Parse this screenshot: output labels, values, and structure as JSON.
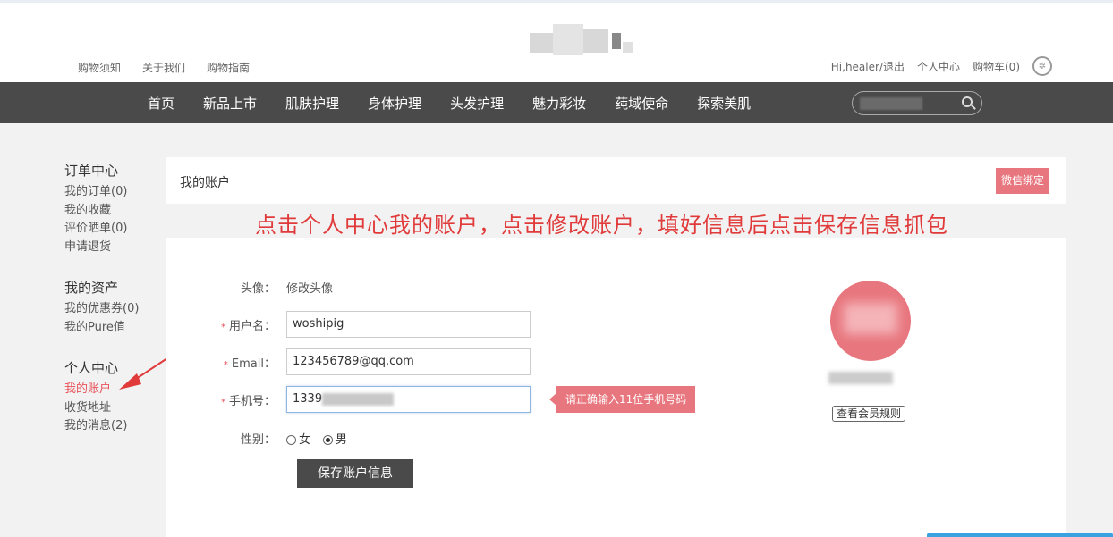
{
  "header": {
    "left_links": [
      "购物须知",
      "关于我们",
      "购物指南"
    ],
    "user_links": [
      "Hi,healer/退出",
      "个人中心",
      "购物车(0)"
    ],
    "wechat_icon": "wechat-icon"
  },
  "nav": {
    "items": [
      "首页",
      "新品上市",
      "肌肤护理",
      "身体护理",
      "头发护理",
      "魅力彩妆",
      "莼域使命",
      "探索美肌"
    ]
  },
  "sidebar": {
    "groups": [
      {
        "title": "订单中心",
        "items": [
          "我的订单(0)",
          "我的收藏",
          "评价晒单(0)",
          "申请退货"
        ]
      },
      {
        "title": "我的资产",
        "items": [
          "我的优惠券(0)",
          "我的Pure值"
        ]
      },
      {
        "title": "个人中心",
        "items": [
          "我的账户",
          "收货地址",
          "我的消息(2)"
        ]
      }
    ],
    "active_item": "我的账户"
  },
  "main": {
    "title": "我的账户",
    "wechat_bind_label": "微信绑定",
    "annotation": "点击个人中心我的账户，点击修改账户，填好信息后点击保存信息抓包",
    "form": {
      "avatar_label": "头像：",
      "avatar_link": "修改头像",
      "username_label": "用户名：",
      "username_value": "woshipig",
      "email_label": "Email：",
      "email_value": "123456789@qq.com",
      "phone_label": "手机号：",
      "phone_value": "1339",
      "phone_tip": "请正确输入11位手机号码",
      "gender_label": "性别：",
      "gender_options": [
        "女",
        "男"
      ],
      "gender_selected": "男",
      "required_mark": "*",
      "save_label": "保存账户信息"
    },
    "member_rules_label": "查看会员规则"
  },
  "colors": {
    "accent": "#e8767e",
    "nav_bg": "#4a4a4a",
    "annotation": "#e03a3a",
    "active_link": "#e8525a"
  }
}
